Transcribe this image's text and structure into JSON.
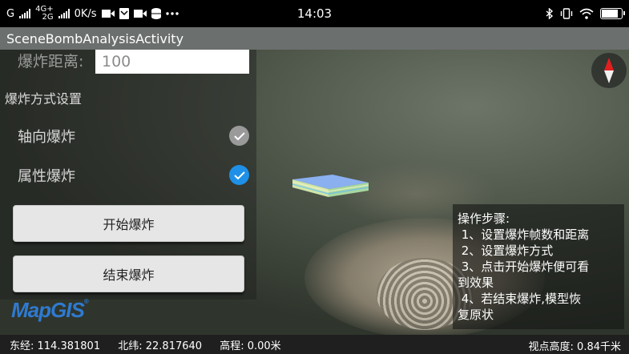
{
  "status_bar": {
    "carrier_g": "G",
    "net_top": "4G+",
    "net_bottom": "2G",
    "speed": "0K/s",
    "time": "14:03",
    "icons_left": [
      "signal-icon",
      "signal-icon",
      "video-icon",
      "mail-icon",
      "video-icon",
      "database-icon",
      "more-icon"
    ],
    "icons_right": [
      "bluetooth-icon",
      "vibrate-icon",
      "wifi-icon",
      "battery-icon"
    ],
    "battery_level": 0.95
  },
  "app": {
    "title": "SceneBombAnalysisActivity"
  },
  "panel": {
    "distance_label": "爆炸距离:",
    "distance_value": "100",
    "section_title": "爆炸方式设置",
    "options": [
      {
        "label": "轴向爆炸",
        "checked": false
      },
      {
        "label": "属性爆炸",
        "checked": true
      }
    ],
    "start_button": "开始爆炸",
    "end_button": "结束爆炸"
  },
  "logo": {
    "text": "MapGIS",
    "mark": "®"
  },
  "instructions": {
    "title": "操作步骤:",
    "lines": [
      " 1、设置爆炸帧数和距离",
      " 2、设置爆炸方式",
      " 3、点击开始爆炸便可看",
      "到效果",
      " 4、若结束爆炸,模型恢",
      "复原状"
    ]
  },
  "bottom": {
    "lon": "东经: 114.381801",
    "lat": "北纬: 22.817640",
    "alt": "高程: 0.00米",
    "view_height": "视点高度: 0.84千米"
  },
  "colors": {
    "check_on": "#1e90e8",
    "check_off": "#9a9a9a",
    "logo": "#2f7ad0",
    "compass_north": "#e02020"
  }
}
